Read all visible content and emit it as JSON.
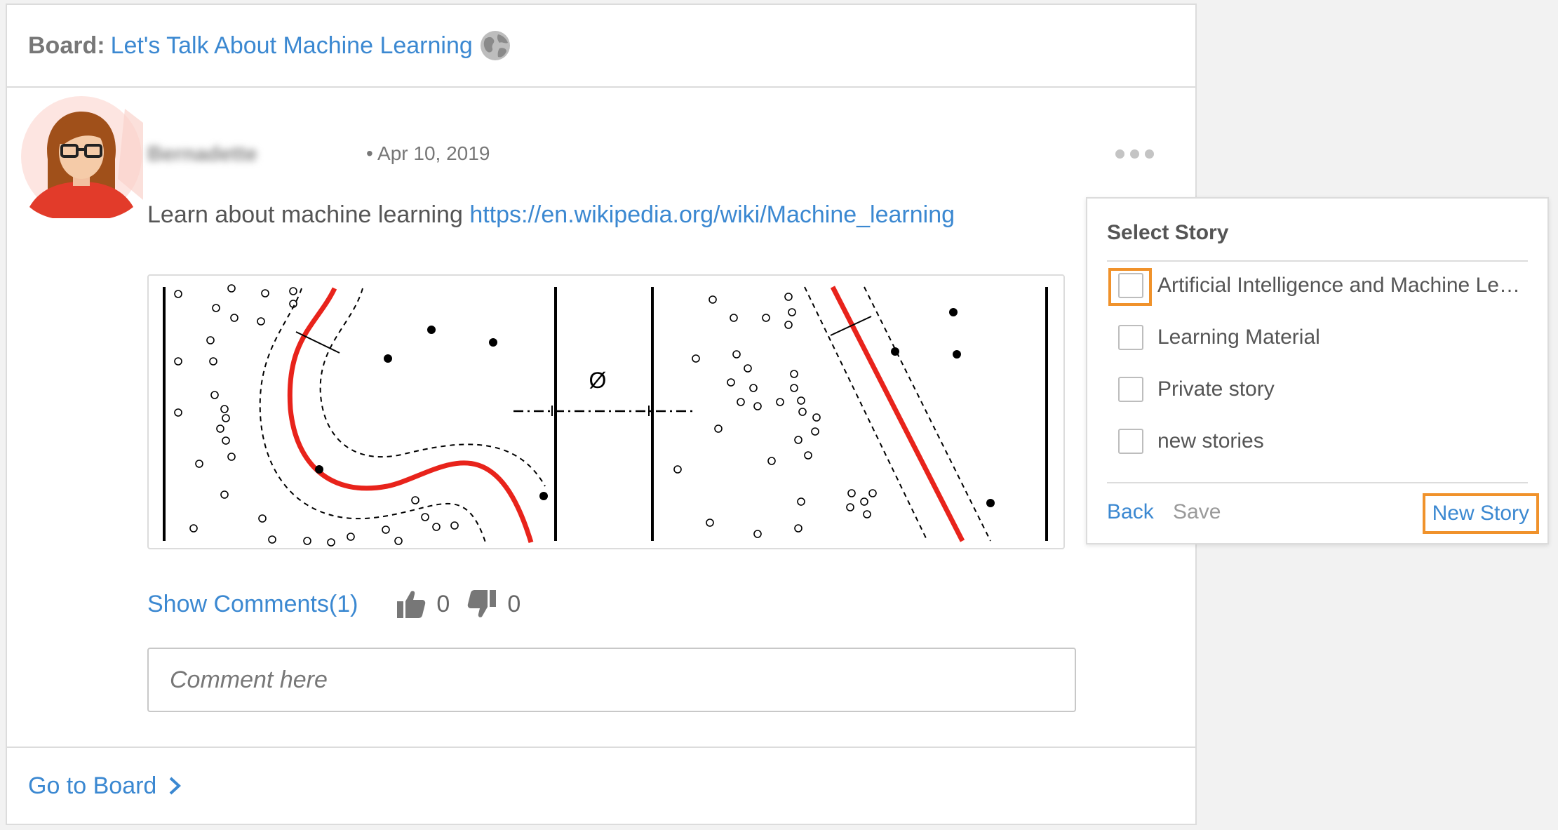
{
  "header": {
    "board_prefix": "Board:",
    "board_name": "Let's Talk About Machine Learning",
    "globe_icon": "globe-icon"
  },
  "post": {
    "author": "Bernadette",
    "date_bullet": "•",
    "date": "Apr 10, 2019",
    "text": "Learn about machine learning ",
    "link": "https://en.wikipedia.org/wiki/Machine_learning",
    "image_icon": "svm-decision-boundary-illustration",
    "phi_symbol": "Ø"
  },
  "actions": {
    "show_comments": "Show Comments(1)",
    "likes": "0",
    "dislikes": "0"
  },
  "comment": {
    "placeholder": "Comment here"
  },
  "footer": {
    "go_to_board": "Go to Board"
  },
  "story_popup": {
    "title": "Select Story",
    "items": [
      {
        "label": "Artificial Intelligence and Machine Le…",
        "checked": false
      },
      {
        "label": "Learning Material",
        "checked": false
      },
      {
        "label": "Private story",
        "checked": false
      },
      {
        "label": "new stories",
        "checked": false
      }
    ],
    "back": "Back",
    "save": "Save",
    "new_story": "New Story"
  },
  "colors": {
    "link": "#3b88d1",
    "highlight": "#f0922b",
    "boundary": "#e8231b"
  }
}
